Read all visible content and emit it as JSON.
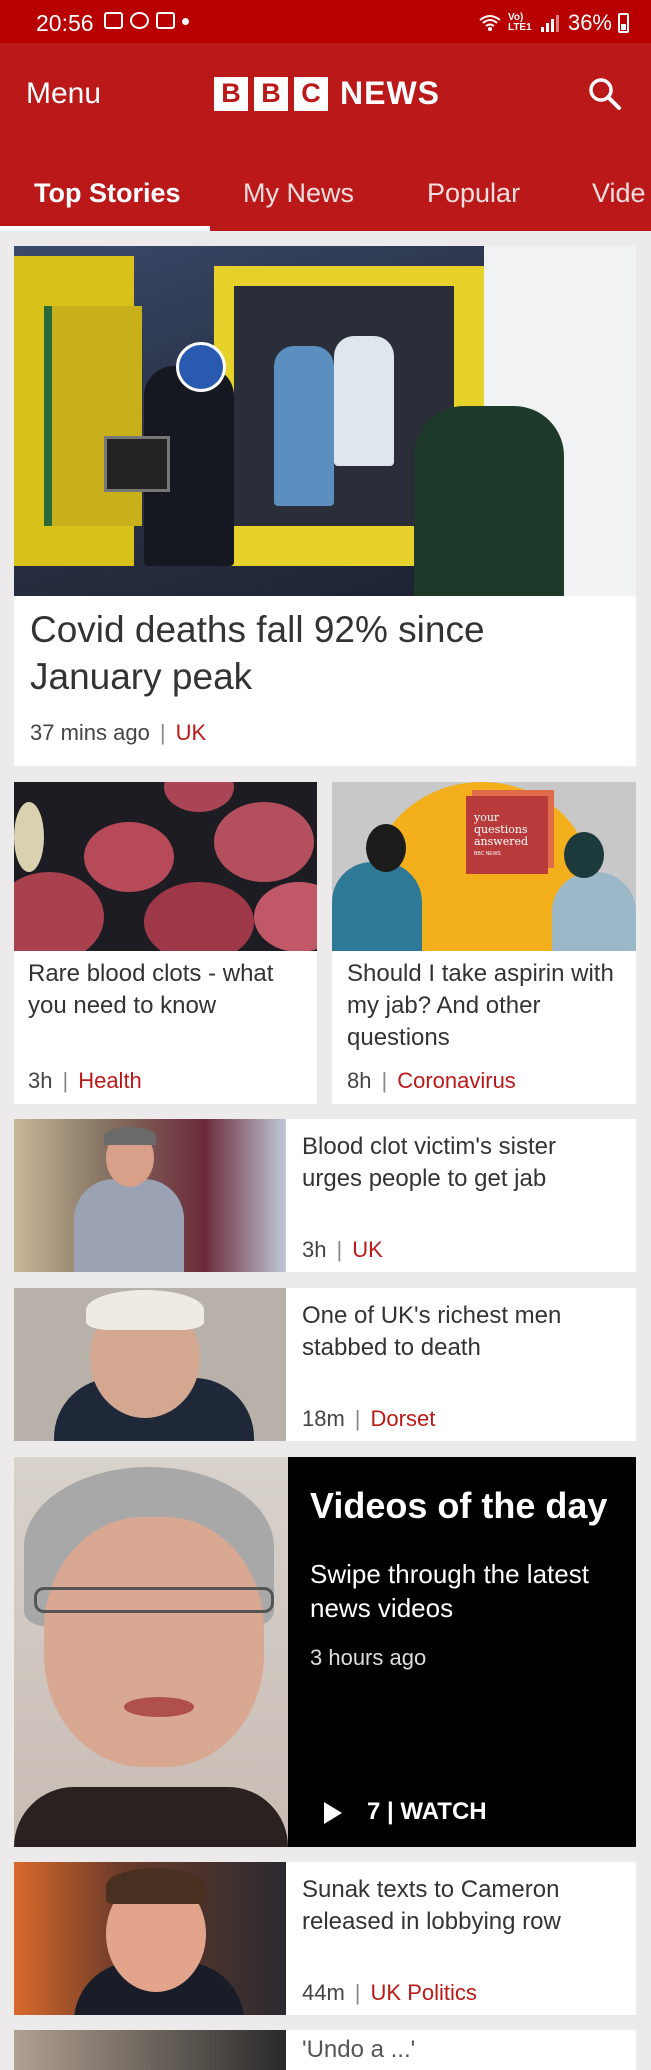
{
  "status_bar": {
    "time": "20:56",
    "network": "Vo) LTE1",
    "battery": "36%"
  },
  "header": {
    "menu_label": "Menu",
    "logo_letters": [
      "B",
      "B",
      "C"
    ],
    "logo_word": "NEWS",
    "tabs": [
      {
        "label": "Top Stories"
      },
      {
        "label": "My News"
      },
      {
        "label": "Popular"
      },
      {
        "label": "Vide"
      }
    ]
  },
  "stories": {
    "lead": {
      "headline": "Covid deaths fall 92% since January peak",
      "time": "37 mins ago",
      "section": "UK"
    },
    "s1": {
      "headline": "Rare blood clots - what you need to know",
      "time": "3h",
      "section": "Health"
    },
    "s2": {
      "headline": "Should I take aspirin with my jab? And other questions",
      "time": "8h",
      "section": "Coronavirus",
      "image_text": [
        "your",
        "questions",
        "answered",
        "BBC NEWS"
      ]
    },
    "s3": {
      "headline": "Blood clot victim's sister urges people to get jab",
      "time": "3h",
      "section": "UK"
    },
    "s4": {
      "headline": "One of UK's richest men stabbed to death",
      "time": "18m",
      "section": "Dorset"
    },
    "video": {
      "title": "Videos of the day",
      "subtitle": "Swipe through the latest news videos",
      "time": "3 hours ago",
      "watch": "7 | WATCH"
    },
    "s5": {
      "headline": "Sunak texts to Cameron released in lobbying row",
      "time": "44m",
      "section": "UK Politics"
    },
    "s6": {
      "headline": "'Undo a ...'"
    }
  },
  "colors": {
    "brand": "#bb1919",
    "status_bar": "#b80000",
    "background": "#eceaea"
  }
}
